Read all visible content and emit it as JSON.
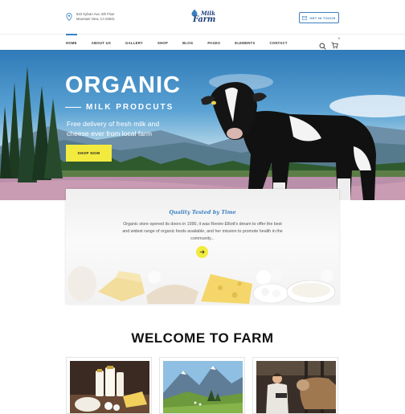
{
  "header": {
    "address_line1": "523 Sylvan Ave, 5th Floor",
    "address_line2": "Mountain View, CA 94041",
    "logo_line1": "Milk",
    "logo_line2": "Farm",
    "cta_label": "GET IN TOUCH"
  },
  "nav": {
    "items": [
      "HOME",
      "ABOUT US",
      "GALLERY",
      "SHOP",
      "BLOG",
      "PAGES",
      "ELEMENTS",
      "CONTACT"
    ],
    "active_index": 0,
    "cart_count": "0"
  },
  "hero": {
    "title": "ORGANIC",
    "subtitle": "MILK PRODCUTS",
    "description": "Free delivery of fresh milk and cheese ever from local farm",
    "button_label": "SHOP NOW"
  },
  "quality": {
    "title": "Quality Tested by Time",
    "text": "Organic store opened its doors in 1990, it was Renée Elliott's dream to offer the best and widest range of organic foods available, and her mission to promote health in the community..."
  },
  "welcome": {
    "title": "WELCOME TO FARM"
  },
  "colors": {
    "accent_blue": "#3a7fc1",
    "accent_yellow": "#f2ea3e",
    "logo_navy": "#1d3f7a"
  },
  "icons": {
    "address": "map-pin-icon",
    "cta": "mail-icon",
    "search": "search-icon",
    "cart": "cart-icon",
    "arrow": "arrow-right-icon"
  }
}
